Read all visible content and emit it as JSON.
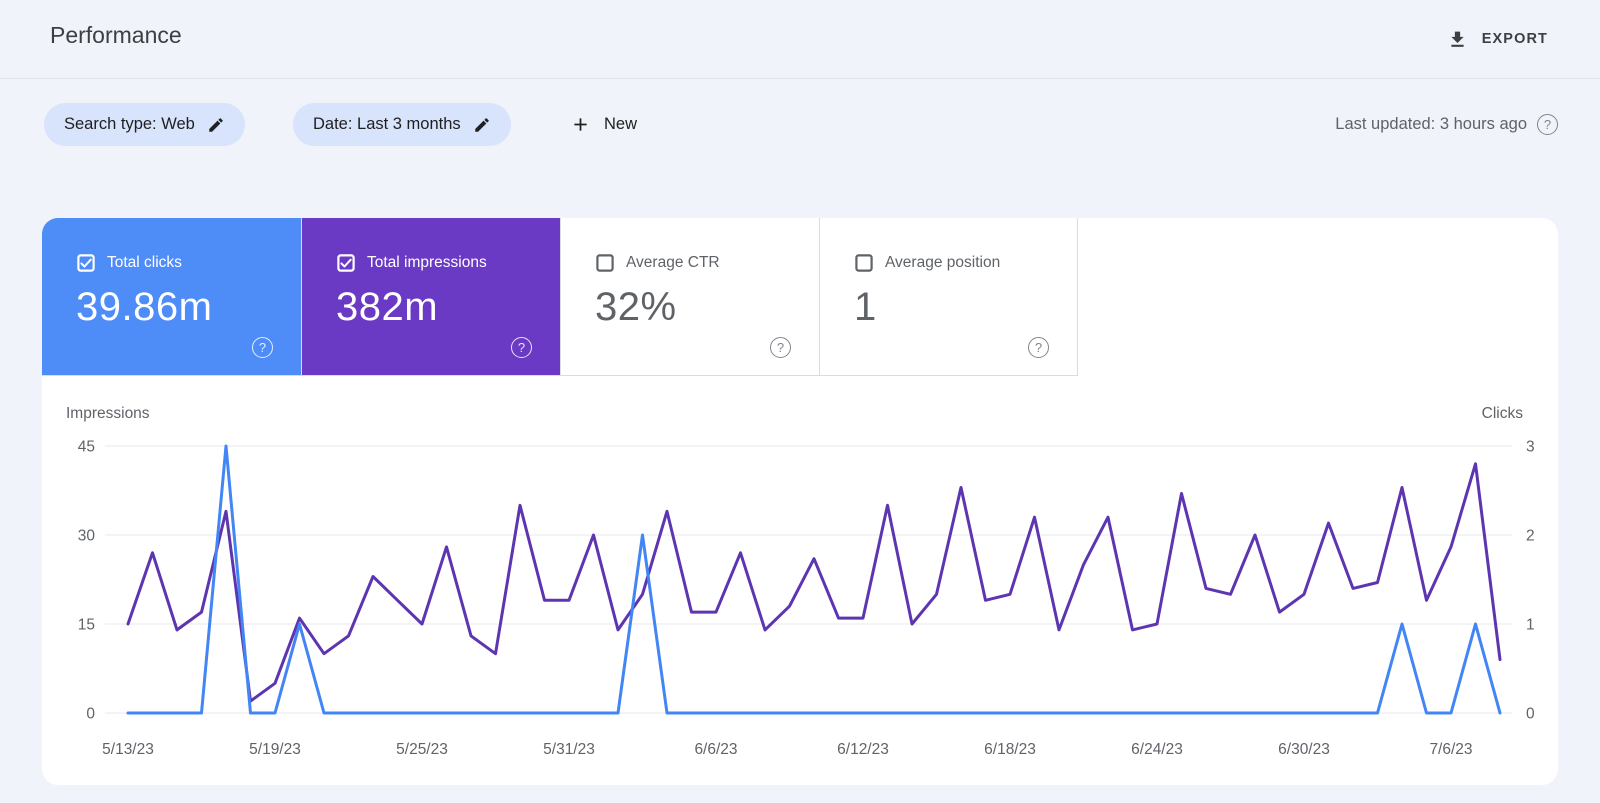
{
  "header": {
    "title": "Performance",
    "export_label": "EXPORT",
    "export_icon": "download-icon"
  },
  "filters": {
    "chips": [
      {
        "label": "Search type: Web",
        "icon": "edit-icon"
      },
      {
        "label": "Date: Last 3 months",
        "icon": "edit-icon"
      }
    ],
    "new_label": "New",
    "new_icon": "plus-icon",
    "last_updated": "Last updated: 3 hours ago",
    "last_updated_icon": "help-icon"
  },
  "metrics": {
    "cards": [
      {
        "label": "Total clicks",
        "value": "39.86m",
        "checked": true,
        "bg": "#4e8cf7",
        "help_icon": "help-icon"
      },
      {
        "label": "Total impressions",
        "value": "382m",
        "checked": true,
        "bg": "#6b3ac4",
        "help_icon": "help-icon"
      },
      {
        "label": "Average CTR",
        "value": "32%",
        "checked": false,
        "bg": "#ffffff",
        "help_icon": "help-icon"
      },
      {
        "label": "Average position",
        "value": "1",
        "checked": false,
        "bg": "#ffffff",
        "help_icon": "help-icon"
      }
    ]
  },
  "chart_data": {
    "type": "line",
    "grid": "horizontal",
    "left_axis": {
      "label": "Impressions",
      "ticks": [
        45,
        30,
        15,
        0
      ],
      "max": 45
    },
    "right_axis": {
      "label": "Clicks",
      "ticks": [
        3,
        2,
        1,
        0
      ],
      "max": 3
    },
    "x_tick_labels": [
      "5/13/23",
      "5/19/23",
      "5/25/23",
      "5/31/23",
      "6/6/23",
      "6/12/23",
      "6/18/23",
      "6/24/23",
      "6/30/23",
      "7/6/23"
    ],
    "x_tick_interval_days": 6,
    "dates": [
      "5/13/23",
      "5/14/23",
      "5/15/23",
      "5/16/23",
      "5/17/23",
      "5/18/23",
      "5/19/23",
      "5/20/23",
      "5/21/23",
      "5/22/23",
      "5/23/23",
      "5/24/23",
      "5/25/23",
      "5/26/23",
      "5/27/23",
      "5/28/23",
      "5/29/23",
      "5/30/23",
      "5/31/23",
      "6/1/23",
      "6/2/23",
      "6/3/23",
      "6/4/23",
      "6/5/23",
      "6/6/23",
      "6/7/23",
      "6/8/23",
      "6/9/23",
      "6/10/23",
      "6/11/23",
      "6/12/23",
      "6/13/23",
      "6/14/23",
      "6/15/23",
      "6/16/23",
      "6/17/23",
      "6/18/23",
      "6/19/23",
      "6/20/23",
      "6/21/23",
      "6/22/23",
      "6/23/23",
      "6/24/23",
      "6/25/23",
      "6/26/23",
      "6/27/23",
      "6/28/23",
      "6/29/23",
      "6/30/23",
      "7/1/23",
      "7/2/23",
      "7/3/23",
      "7/4/23",
      "7/5/23",
      "7/6/23",
      "7/7/23",
      "7/8/23"
    ],
    "series": [
      {
        "name": "Impressions",
        "axis": "left",
        "color": "#5e35b1",
        "values": [
          15,
          27,
          14,
          17,
          34,
          2,
          5,
          16,
          10,
          13,
          23,
          19,
          15,
          28,
          13,
          10,
          35,
          19,
          19,
          30,
          14,
          20,
          34,
          17,
          17,
          27,
          14,
          18,
          26,
          16,
          16,
          35,
          15,
          20,
          38,
          19,
          20,
          33,
          14,
          25,
          33,
          14,
          15,
          37,
          21,
          20,
          30,
          17,
          20,
          32,
          21,
          22,
          38,
          19,
          28,
          42,
          9
        ]
      },
      {
        "name": "Clicks",
        "axis": "right",
        "color": "#4285f4",
        "values": [
          0,
          0,
          0,
          0,
          3,
          0,
          0,
          1,
          0,
          0,
          0,
          0,
          0,
          0,
          0,
          0,
          0,
          0,
          0,
          0,
          0,
          2,
          0,
          0,
          0,
          0,
          0,
          0,
          0,
          0,
          0,
          0,
          0,
          0,
          0,
          0,
          0,
          0,
          0,
          0,
          0,
          0,
          0,
          0,
          0,
          0,
          0,
          0,
          0,
          0,
          0,
          0,
          1,
          0,
          0,
          1,
          0
        ]
      }
    ]
  },
  "colors": {
    "clicks_card": "#4e8cf7",
    "impressions_card": "#6b3ac4",
    "clicks_line": "#4285f4",
    "impressions_line": "#5e35b1",
    "chip_bg": "#d8e3fc",
    "page_bg": "#f0f3fa",
    "gridline": "#e8eaee",
    "muted_text": "#5f6368"
  }
}
